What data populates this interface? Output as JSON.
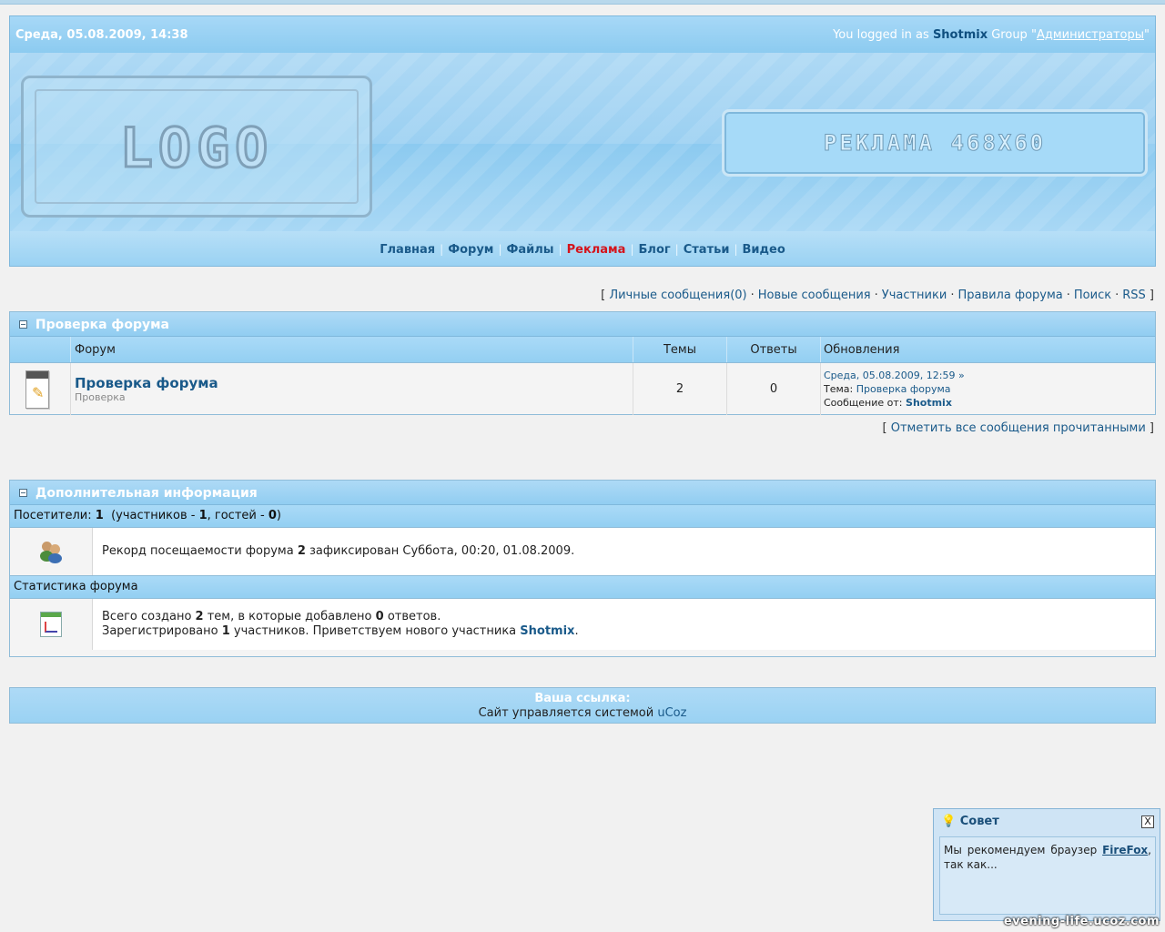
{
  "header": {
    "datetime": "Среда, 05.08.2009, 14:38",
    "logged_prefix": "You logged in as",
    "username": "Shotmix",
    "group_prefix": "Group \"",
    "group": "Администраторы",
    "group_suffix": "\"",
    "logo_text": "LOGO",
    "ad_text": "РЕКЛАМА 468X60"
  },
  "nav": {
    "items": [
      "Главная",
      "Форум",
      "Файлы",
      "Реклама",
      "Блог",
      "Статьи",
      "Видео"
    ],
    "highlight_color": "#d4141c"
  },
  "toplinks": {
    "open": "[",
    "items": [
      "Личные сообщения(0)",
      "Новые сообщения",
      "Участники",
      "Правила форума",
      "Поиск",
      "RSS"
    ],
    "close": "]"
  },
  "forum_section": {
    "title": "Проверка форума",
    "columns": [
      "Форум",
      "Темы",
      "Ответы",
      "Обновления"
    ],
    "row": {
      "name": "Проверка форума",
      "description": "Проверка",
      "topics": "2",
      "replies": "0",
      "last_date": "Среда, 05.08.2009, 12:59",
      "topic_label": "Тема:",
      "topic_link": "Проверка форума",
      "msg_label": "Сообщение от:",
      "msg_author": "Shotmix"
    },
    "mark_all": "Отметить все сообщения прочитанными"
  },
  "info_section": {
    "title": "Дополнительная информация",
    "visitors_label": "Посетители:",
    "visitors_count": "1",
    "visitors_detail_1": "(участников -",
    "members_count": "1",
    "visitors_detail_2": ", гостей -",
    "guests_count": "0",
    "visitors_detail_3": ")",
    "record_1": "Рекорд посещаемости форума",
    "record_count": "2",
    "record_2": "зафиксирован Суббота, 00:20, 01.08.2009.",
    "stats_title": "Статистика форума",
    "stats_1a": "Всего создано",
    "stats_topics": "2",
    "stats_1b": "тем, в которые добавлено",
    "stats_replies": "0",
    "stats_1c": "ответов.",
    "stats_2a": "Зарегистрировано",
    "stats_members": "1",
    "stats_2b": "участников. Приветствуем нового участника",
    "stats_newest": "Shotmix",
    "stats_2c": "."
  },
  "footer": {
    "line1": "Ваша ссылка:",
    "line2_text": "Сайт управляется системой",
    "line2_link": "uCoz"
  },
  "tip": {
    "title": "Совет",
    "close": "X",
    "text_before": "Мы рекомендуем браузер",
    "link": "FireFox",
    "text_after": ", так как..."
  },
  "watermark": "evening-life.ucoz.com"
}
